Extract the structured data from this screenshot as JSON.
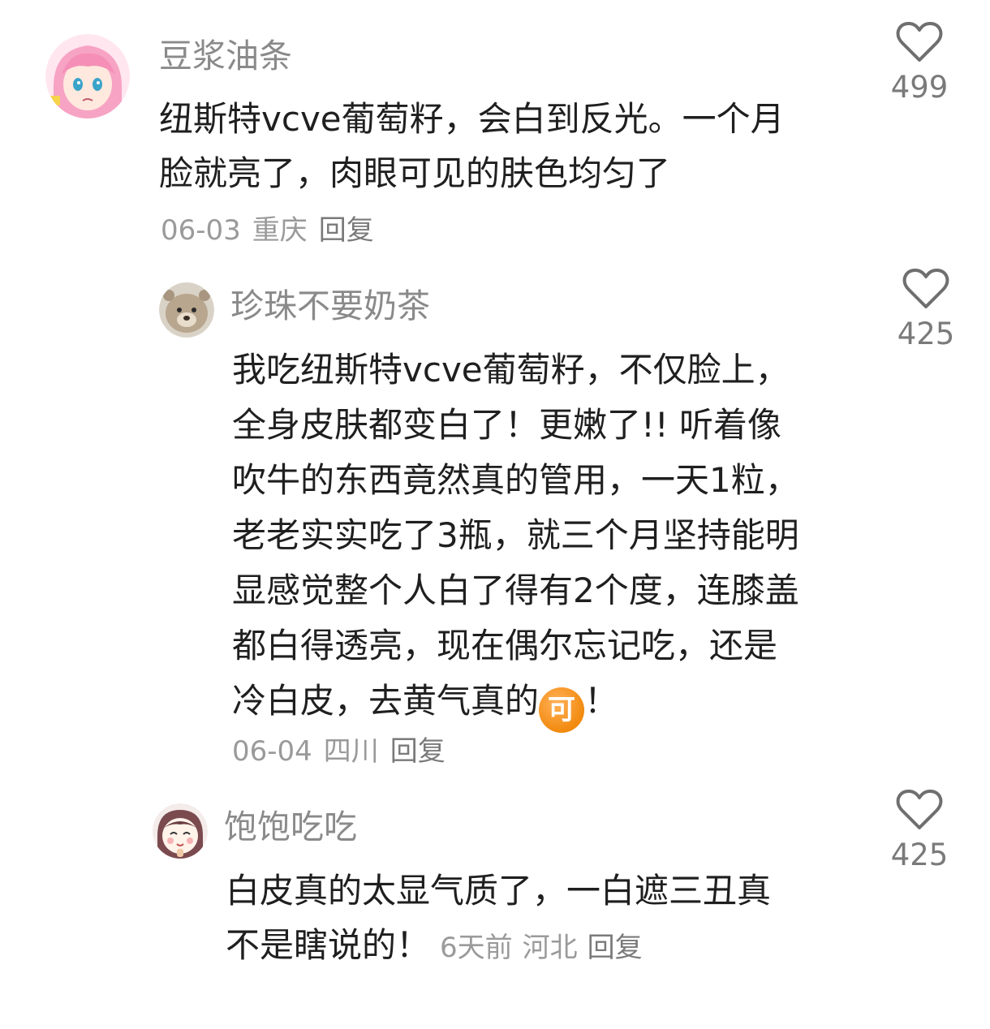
{
  "comments": [
    {
      "username": "豆浆油条",
      "lines": [
        "纽斯特vcve葡萄籽，会白到反光。一个月",
        "脸就亮了，肉眼可见的肤色均匀了"
      ],
      "date": "06-03",
      "location": "重庆",
      "reply_label": "回复",
      "likes": "499",
      "avatar_icon": "anime-pink-hair-avatar"
    },
    {
      "username": "珍珠不要奶茶",
      "lines": [
        "我吃纽斯特vcve葡萄籽，不仅脸上，",
        "全身皮肤都变白了！更嫩了!! 听着像",
        "吹牛的东西竟然真的管用，一天1粒，",
        "老老实实吃了3瓶，就三个月坚持能明",
        "显感觉整个人白了得有2个度，连膝盖",
        "都白得透亮，现在偶尔忘记吃，还是"
      ],
      "last_line_text": "冷白皮，去黄气真的",
      "emoji_text": "可",
      "last_line_suffix": "！",
      "date": "06-04",
      "location": "四川",
      "reply_label": "回复",
      "likes": "425",
      "avatar_icon": "plush-bear-avatar"
    },
    {
      "username": "饱饱吃吃",
      "lines": [
        "白皮真的太显气质了，一白遮三丑真"
      ],
      "last_line_text": "不是瞎说的！",
      "date": "6天前",
      "location": "河北",
      "reply_label": "回复",
      "likes": "425",
      "avatar_icon": "cartoon-girl-avatar"
    }
  ],
  "colors": {
    "text": "#1f1f1f",
    "muted": "#9a9a9a",
    "like_icon": "#6f6f6f",
    "emoji": "#f28a0e"
  }
}
